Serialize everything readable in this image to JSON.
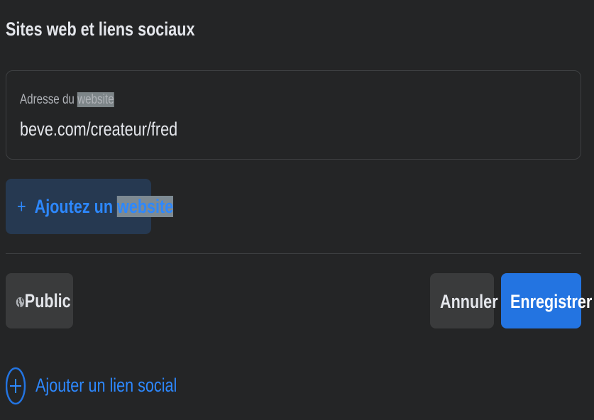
{
  "section_title": "Sites web et liens sociaux",
  "website_field": {
    "label_prefix": "Adresse du",
    "label_highlight": "website",
    "value": "beve.com/createur/fred"
  },
  "add_website": {
    "icon": "plus-icon",
    "label_prefix": "Ajoutez un",
    "label_highlight": "website"
  },
  "privacy_button": {
    "icon": "globe-icon",
    "label": "Public"
  },
  "cancel_label": "Annuler",
  "save_label": "Enregistrer",
  "add_social": {
    "icon": "plus-circle-icon",
    "label": "Ajouter un lien social"
  },
  "colors": {
    "background": "#242526",
    "accent": "#2d88ff",
    "primary_button": "#2374e1",
    "secondary_button": "#3a3b3c"
  }
}
